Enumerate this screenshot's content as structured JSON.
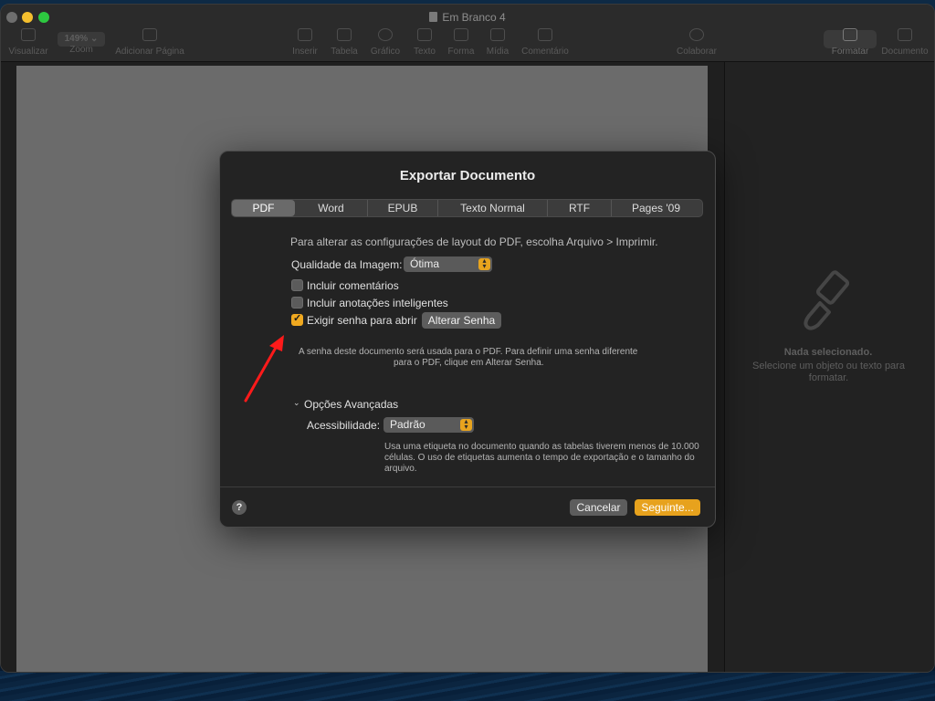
{
  "window": {
    "title": "Em Branco 4"
  },
  "toolbar": {
    "items": [
      {
        "label": "Visualizar"
      },
      {
        "label": "Zoom"
      },
      {
        "label": "Adicionar Página"
      },
      {
        "label": "Inserir"
      },
      {
        "label": "Tabela"
      },
      {
        "label": "Gráfico"
      },
      {
        "label": "Texto"
      },
      {
        "label": "Forma"
      },
      {
        "label": "Mídia"
      },
      {
        "label": "Comentário"
      },
      {
        "label": "Colaborar"
      },
      {
        "label": "Formatar"
      },
      {
        "label": "Documento"
      }
    ],
    "zoom_value": "149%"
  },
  "sidebar": {
    "title": "Nada selecionado.",
    "text": "Selecione um objeto ou texto para formatar."
  },
  "dialog": {
    "title": "Exportar Documento",
    "tabs": [
      {
        "label": "PDF",
        "active": true
      },
      {
        "label": "Word"
      },
      {
        "label": "EPUB"
      },
      {
        "label": "Texto Normal"
      },
      {
        "label": "RTF"
      },
      {
        "label": "Pages '09"
      }
    ],
    "info": "Para alterar as configurações de layout do PDF, escolha Arquivo > Imprimir.",
    "image_quality": {
      "label": "Qualidade da Imagem:",
      "value": "Ótima"
    },
    "checkboxes": [
      {
        "label": "Incluir comentários",
        "checked": false
      },
      {
        "label": "Incluir anotações inteligentes",
        "checked": false
      },
      {
        "label": "Exigir senha para abrir",
        "checked": true
      }
    ],
    "change_password_button": "Alterar Senha",
    "password_note_1": "A senha deste documento será usada para o PDF. Para definir uma senha diferente",
    "password_note_2": "para o PDF, clique em Alterar Senha.",
    "advanced_label": "Opções Avançadas",
    "accessibility": {
      "label": "Acessibilidade:",
      "value": "Padrão"
    },
    "accessibility_note_1": "Usa uma etiqueta no documento quando as tabelas tiverem menos de 10.000",
    "accessibility_note_2": "células. O uso de etiquetas aumenta o tempo de exportação e o tamanho do",
    "accessibility_note_3": "arquivo.",
    "help_label": "?",
    "cancel_button": "Cancelar",
    "next_button": "Seguinte..."
  },
  "colors": {
    "accent": "#e7a21d",
    "annotation_arrow": "#ff1a1a"
  }
}
